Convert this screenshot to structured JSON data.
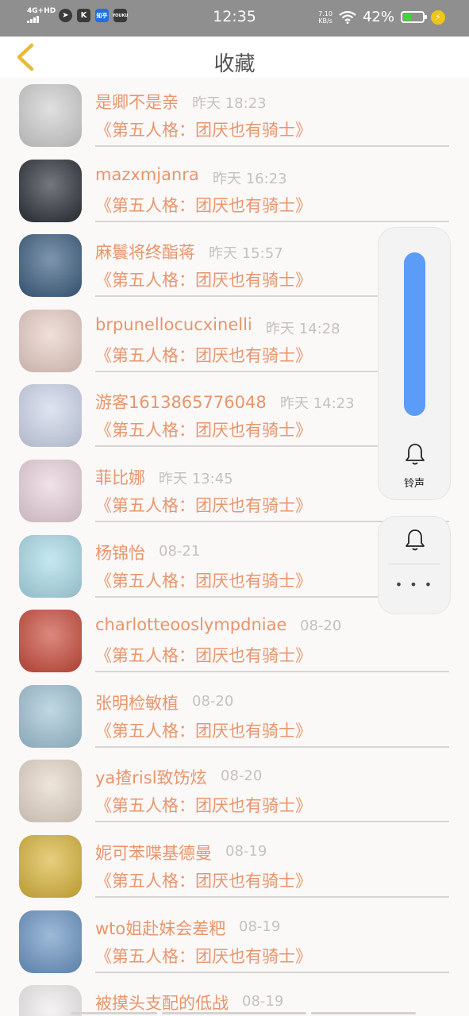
{
  "status_bar": {
    "network": "4G+HD",
    "apps": [
      "K",
      "知乎",
      "YOUKU"
    ],
    "time": "12:35",
    "speed_value": "7.10",
    "speed_unit": "KB/s",
    "battery_percent": "42%",
    "battery_level": 0.42
  },
  "header": {
    "title": "收藏",
    "back_icon": "chevron-left-icon",
    "accent_color": "#e8b93a"
  },
  "items": [
    {
      "name": "是卿不是亲",
      "time": "昨天 18:23",
      "title": "《第五人格：团厌也有骑士》",
      "avatar_color": "#cfcfcf"
    },
    {
      "name": "mazxmjanra",
      "time": "昨天 16:23",
      "title": "《第五人格：团厌也有骑士》",
      "avatar_color": "#2a2f37"
    },
    {
      "name": "麻鬟将终酯蒋",
      "time": "昨天 15:57",
      "title": "《第五人格：团厌也有骑士》",
      "avatar_color": "#3a5d80"
    },
    {
      "name": "brpunellocucxinelli",
      "time": "昨天 14:28",
      "title": "《第五人格：团厌也有骑士》",
      "avatar_color": "#e8cfc6"
    },
    {
      "name": "游客1613865776048",
      "time": "昨天 14:23",
      "title": "《第五人格：团厌也有骑士》",
      "avatar_color": "#cdd6ea"
    },
    {
      "name": "菲比娜",
      "time": "昨天 13:45",
      "title": "《第五人格：团厌也有骑士》",
      "avatar_color": "#e9d3dc"
    },
    {
      "name": "杨锦怡",
      "time": "08-21",
      "title": "《第五人格：团厌也有骑士》",
      "avatar_color": "#a9dbe8"
    },
    {
      "name": "charlotteooslympdniae",
      "time": "08-20",
      "title": "《第五人格：团厌也有骑士》",
      "avatar_color": "#c94a3a"
    },
    {
      "name": "张明检敏植",
      "time": "08-20",
      "title": "《第五人格：团厌也有骑士》",
      "avatar_color": "#9fc3d4"
    },
    {
      "name": "ya揸risl致饬炫",
      "time": "08-20",
      "title": "《第五人格：团厌也有骑士》",
      "avatar_color": "#e5d8c9"
    },
    {
      "name": "妮可苯喋基德曼",
      "time": "08-19",
      "title": "《第五人格：团厌也有骑士》",
      "avatar_color": "#d9b53a"
    },
    {
      "name": "wto姐赴妹会差粑",
      "time": "08-19",
      "title": "《第五人格：团厌也有骑士》",
      "avatar_color": "#6a95c4"
    },
    {
      "name": "被摸头支配的低战",
      "time": "08-19",
      "title": "",
      "avatar_color": "#f0eeee"
    }
  ],
  "volume_overlay": {
    "level": 1.0,
    "label": "铃声",
    "bell_icon": "bell-icon",
    "more_icon": "more-dots-icon",
    "more_text": "• • •",
    "track_color": "#5a9cf8"
  }
}
